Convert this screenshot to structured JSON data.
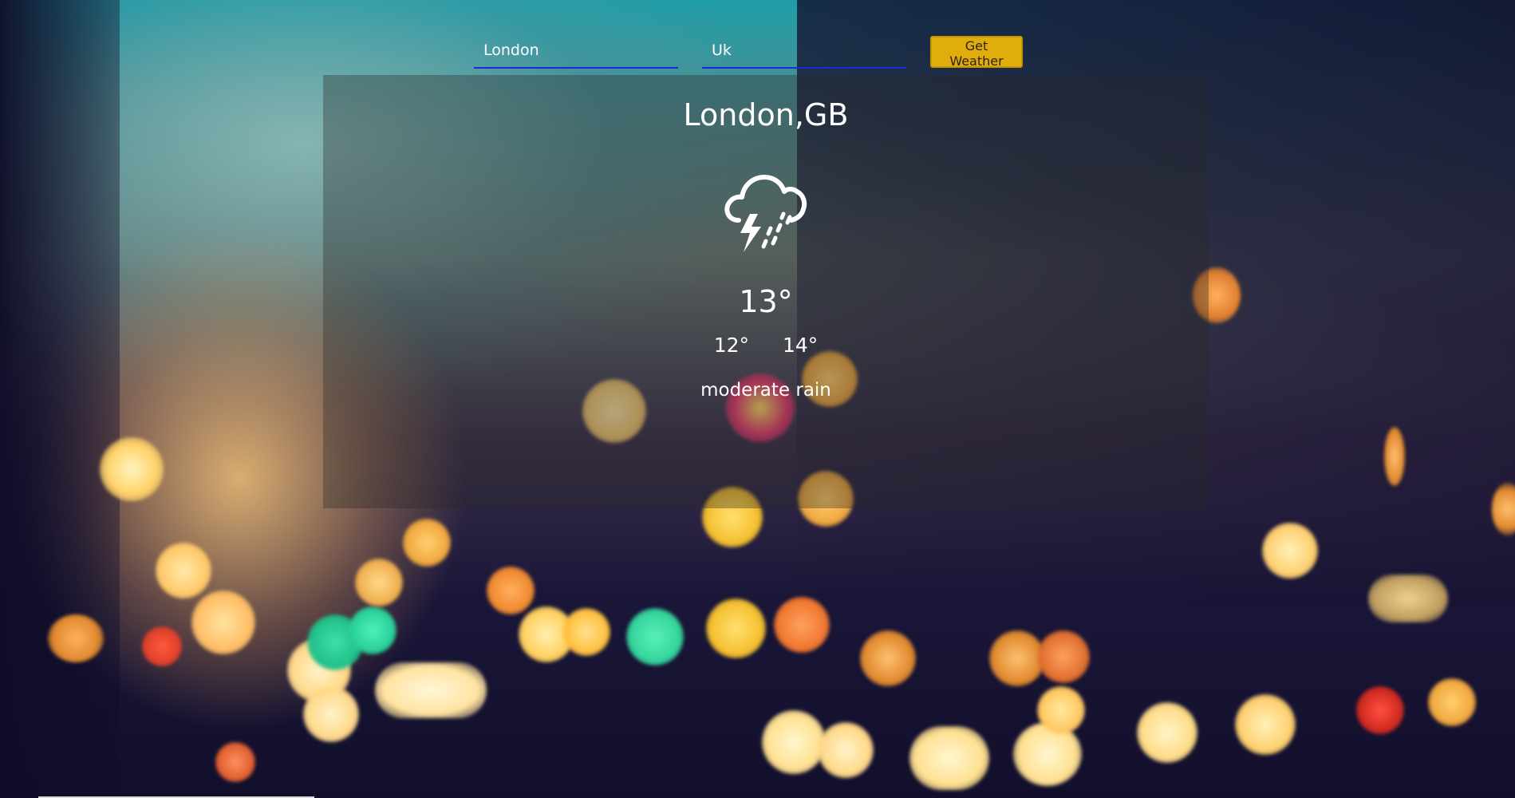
{
  "search": {
    "city_value": "London",
    "country_value": "Uk",
    "button_label": "Get Weather"
  },
  "weather": {
    "location": "London,GB",
    "icon": "thunderstorm-rain-icon",
    "temperature": "13°",
    "temp_min": "12°",
    "temp_max": "14°",
    "description": "moderate rain"
  },
  "colors": {
    "button_bg": "#e0ad0c",
    "input_underline": "#1a2bd6",
    "text": "#ffffff"
  }
}
